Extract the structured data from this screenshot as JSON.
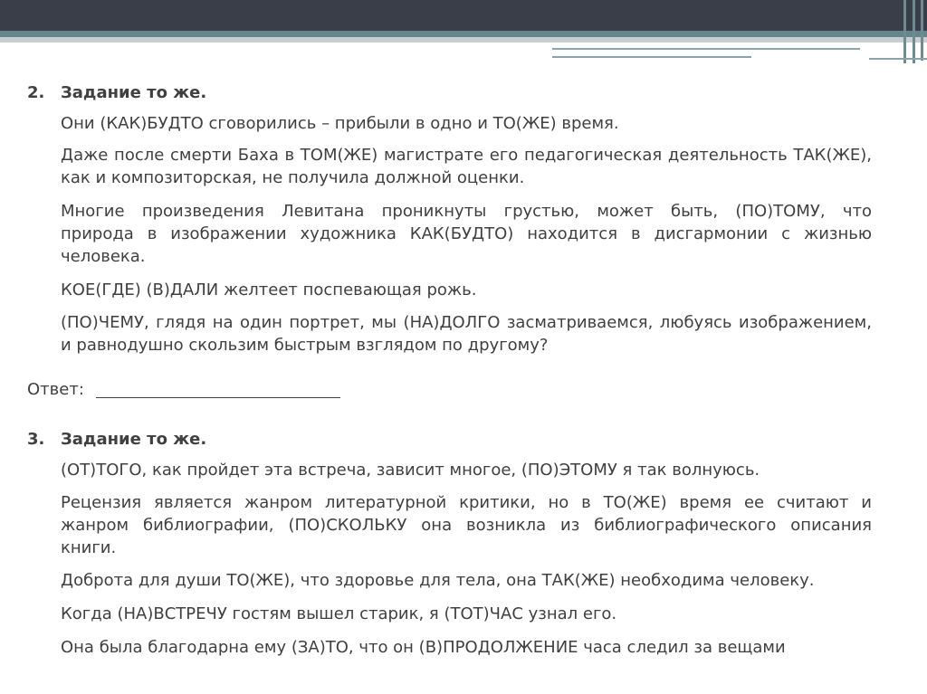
{
  "tasks": [
    {
      "number": "2.",
      "title": "Задание то же.",
      "lines": [
        "Они (КАК)БУДТО сговорились – прибыли в одно и ТО(ЖЕ) время.",
        "Даже после смерти Баха в ТОМ(ЖЕ) магистрате его педагогическая деятельность ТАК(ЖЕ),",
        "как и композиторская, не получила должной оценки.",
        "Многие произведения Левитана проникнуты грустью, может быть, (ПО)ТОМУ, что",
        "природа в изображении художника КАК(БУДТО) находится в дисгармонии с жизнью",
        "человека.",
        "КОЕ(ГДЕ) (В)ДАЛИ желтеет поспевающая рожь.",
        "(ПО)ЧЕМУ, глядя на один портрет, мы (НА)ДОЛГО засматриваемся, любуясь изображением,",
        "и равнодушно скользим быстрым взглядом по другому?"
      ]
    },
    {
      "number": "3.",
      "title": "Задание то же.",
      "lines": [
        "(ОТ)ТОГО, как пройдет эта встреча, зависит многое, (ПО)ЭТОМУ я так волнуюсь.",
        "Рецензия является жанром литературной критики, но в ТО(ЖЕ) время ее считают и",
        "жанром библиографии, (ПО)СКОЛЬКУ она возникла из библиографического описания",
        "книги.",
        "Доброта для души ТО(ЖЕ), что здоровье для тела, она ТАК(ЖЕ) необходима человеку.",
        "Когда (НА)ВСТРЕЧУ гостям вышел старик, я (ТОТ)ЧАС узнал его.",
        "Она была благодарна ему (ЗА)ТО, что он (В)ПРОДОЛЖЕНИЕ часа следил за вещами"
      ]
    }
  ],
  "answer_label": "Ответ:"
}
